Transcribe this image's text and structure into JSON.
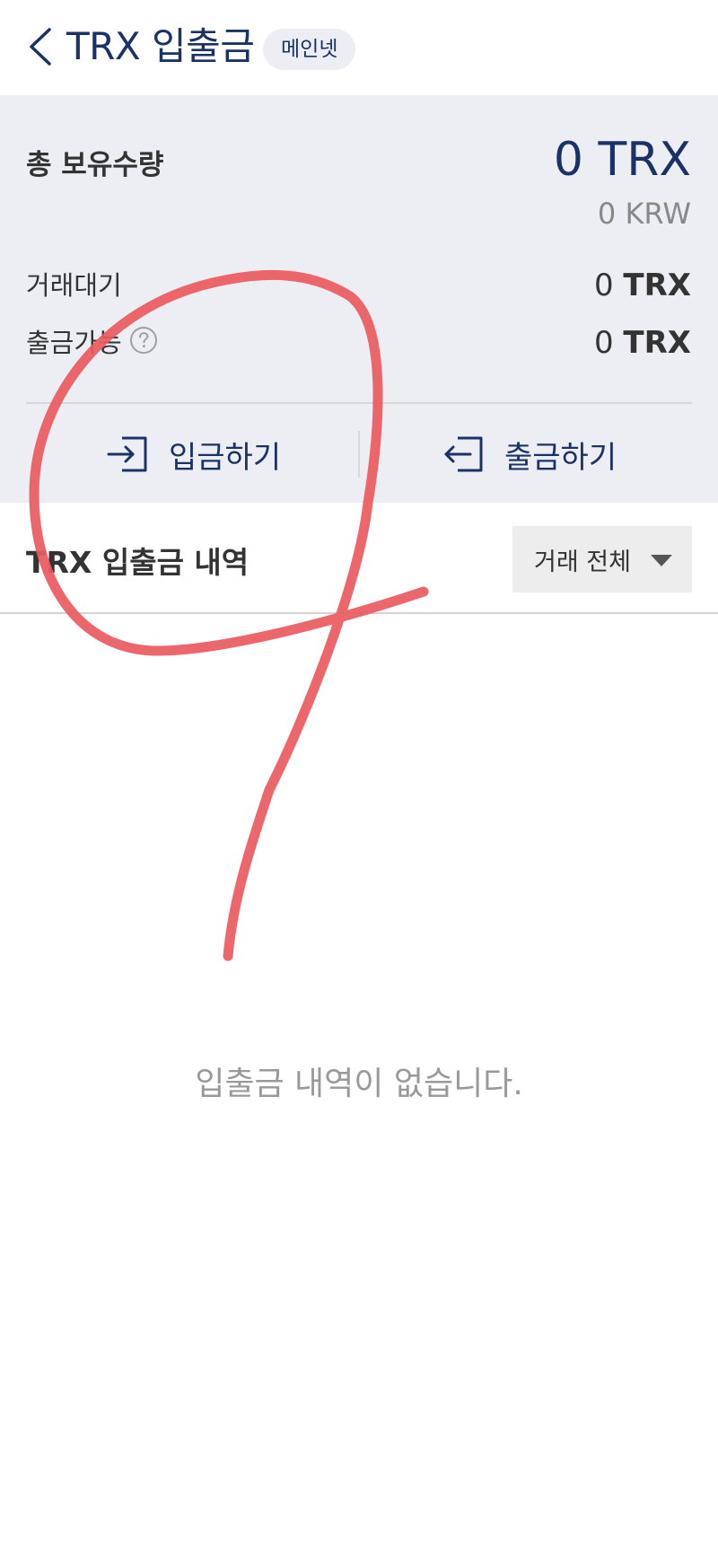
{
  "header": {
    "title": "TRX 입출금",
    "network_badge": "메인넷"
  },
  "summary": {
    "total_label": "총 보유수량",
    "total_amount": "0 TRX",
    "total_krw": "0 KRW",
    "pending_label": "거래대기",
    "pending_value": "0",
    "pending_unit": "TRX",
    "available_label": "출금가능",
    "available_value": "0",
    "available_unit": "TRX"
  },
  "actions": {
    "deposit_label": "입금하기",
    "withdraw_label": "출금하기"
  },
  "history": {
    "title": "TRX 입출금 내역",
    "filter_value": "거래 전체",
    "empty_message": "입출금 내역이 없습니다."
  },
  "icons": {
    "back": "chevron-left-icon",
    "help": "question-circle-icon",
    "deposit": "deposit-arrow-icon",
    "withdraw": "withdraw-arrow-icon",
    "caret": "caret-down-icon"
  },
  "colors": {
    "primary": "#1a3266",
    "panel_bg": "#edeef3",
    "annotation": "#ea5a5f"
  }
}
